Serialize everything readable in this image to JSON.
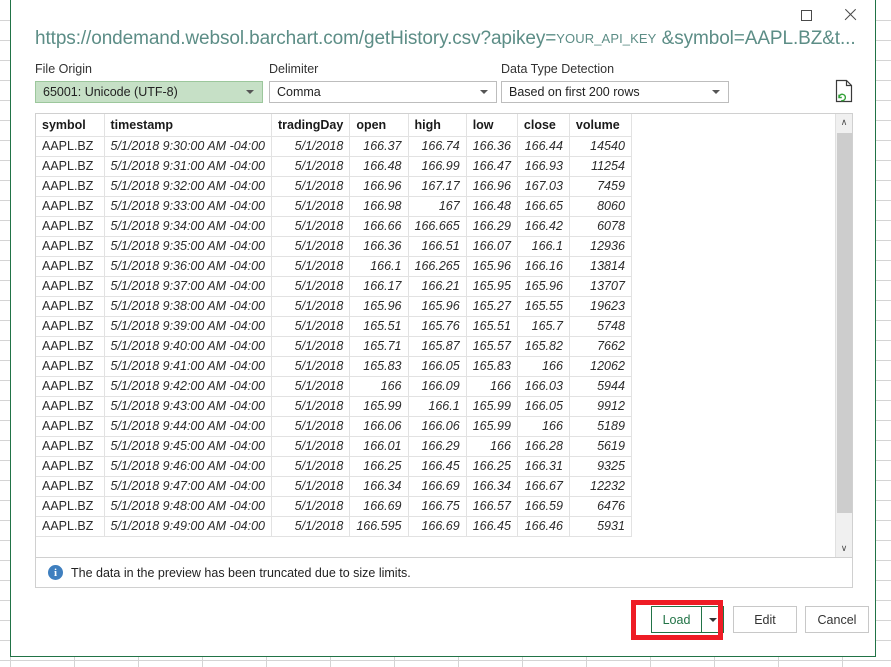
{
  "window": {
    "title_prefix": "https://ondemand.websol.barchart.com/getHistory.csv?apikey=",
    "title_token": "YOUR_API_KEY",
    "title_suffix": " &symbol=AAPL.BZ&t...",
    "maximize_label": "□",
    "close_label": "✕",
    "accent_color": "#217346"
  },
  "fields": {
    "file_origin": {
      "label": "File Origin",
      "value": "65001: Unicode (UTF-8)"
    },
    "delimiter": {
      "label": "Delimiter",
      "value": "Comma"
    },
    "data_type_detection": {
      "label": "Data Type Detection",
      "value": "Based on first 200 rows"
    },
    "refresh_icon_name": "refresh-document-icon"
  },
  "preview": {
    "columns": [
      "symbol",
      "timestamp",
      "tradingDay",
      "open",
      "high",
      "low",
      "close",
      "volume"
    ],
    "rows": [
      [
        "AAPL.BZ",
        "5/1/2018 9:30:00 AM -04:00",
        "5/1/2018",
        "166.37",
        "166.74",
        "166.36",
        "166.44",
        "14540"
      ],
      [
        "AAPL.BZ",
        "5/1/2018 9:31:00 AM -04:00",
        "5/1/2018",
        "166.48",
        "166.99",
        "166.47",
        "166.93",
        "11254"
      ],
      [
        "AAPL.BZ",
        "5/1/2018 9:32:00 AM -04:00",
        "5/1/2018",
        "166.96",
        "167.17",
        "166.96",
        "167.03",
        "7459"
      ],
      [
        "AAPL.BZ",
        "5/1/2018 9:33:00 AM -04:00",
        "5/1/2018",
        "166.98",
        "167",
        "166.48",
        "166.65",
        "8060"
      ],
      [
        "AAPL.BZ",
        "5/1/2018 9:34:00 AM -04:00",
        "5/1/2018",
        "166.66",
        "166.665",
        "166.29",
        "166.42",
        "6078"
      ],
      [
        "AAPL.BZ",
        "5/1/2018 9:35:00 AM -04:00",
        "5/1/2018",
        "166.36",
        "166.51",
        "166.07",
        "166.1",
        "12936"
      ],
      [
        "AAPL.BZ",
        "5/1/2018 9:36:00 AM -04:00",
        "5/1/2018",
        "166.1",
        "166.265",
        "165.96",
        "166.16",
        "13814"
      ],
      [
        "AAPL.BZ",
        "5/1/2018 9:37:00 AM -04:00",
        "5/1/2018",
        "166.17",
        "166.21",
        "165.95",
        "165.96",
        "13707"
      ],
      [
        "AAPL.BZ",
        "5/1/2018 9:38:00 AM -04:00",
        "5/1/2018",
        "165.96",
        "165.96",
        "165.27",
        "165.55",
        "19623"
      ],
      [
        "AAPL.BZ",
        "5/1/2018 9:39:00 AM -04:00",
        "5/1/2018",
        "165.51",
        "165.76",
        "165.51",
        "165.7",
        "5748"
      ],
      [
        "AAPL.BZ",
        "5/1/2018 9:40:00 AM -04:00",
        "5/1/2018",
        "165.71",
        "165.87",
        "165.57",
        "165.82",
        "7662"
      ],
      [
        "AAPL.BZ",
        "5/1/2018 9:41:00 AM -04:00",
        "5/1/2018",
        "165.83",
        "166.05",
        "165.83",
        "166",
        "12062"
      ],
      [
        "AAPL.BZ",
        "5/1/2018 9:42:00 AM -04:00",
        "5/1/2018",
        "166",
        "166.09",
        "166",
        "166.03",
        "5944"
      ],
      [
        "AAPL.BZ",
        "5/1/2018 9:43:00 AM -04:00",
        "5/1/2018",
        "165.99",
        "166.1",
        "165.99",
        "166.05",
        "9912"
      ],
      [
        "AAPL.BZ",
        "5/1/2018 9:44:00 AM -04:00",
        "5/1/2018",
        "166.06",
        "166.06",
        "165.99",
        "166",
        "5189"
      ],
      [
        "AAPL.BZ",
        "5/1/2018 9:45:00 AM -04:00",
        "5/1/2018",
        "166.01",
        "166.29",
        "166",
        "166.28",
        "5619"
      ],
      [
        "AAPL.BZ",
        "5/1/2018 9:46:00 AM -04:00",
        "5/1/2018",
        "166.25",
        "166.45",
        "166.25",
        "166.31",
        "9325"
      ],
      [
        "AAPL.BZ",
        "5/1/2018 9:47:00 AM -04:00",
        "5/1/2018",
        "166.34",
        "166.69",
        "166.34",
        "166.67",
        "12232"
      ],
      [
        "AAPL.BZ",
        "5/1/2018 9:48:00 AM -04:00",
        "5/1/2018",
        "166.69",
        "166.75",
        "166.57",
        "166.59",
        "6476"
      ],
      [
        "AAPL.BZ",
        "5/1/2018 9:49:00 AM -04:00",
        "5/1/2018",
        "166.595",
        "166.69",
        "166.45",
        "166.46",
        "5931"
      ]
    ],
    "scroll_up_glyph": "∧",
    "scroll_down_glyph": "∨"
  },
  "notice": {
    "icon_label": "i",
    "text": "The data in the preview has been truncated due to size limits."
  },
  "footer": {
    "load_label": "Load",
    "edit_label": "Edit",
    "cancel_label": "Cancel",
    "annotation_color": "#ee1c25"
  }
}
